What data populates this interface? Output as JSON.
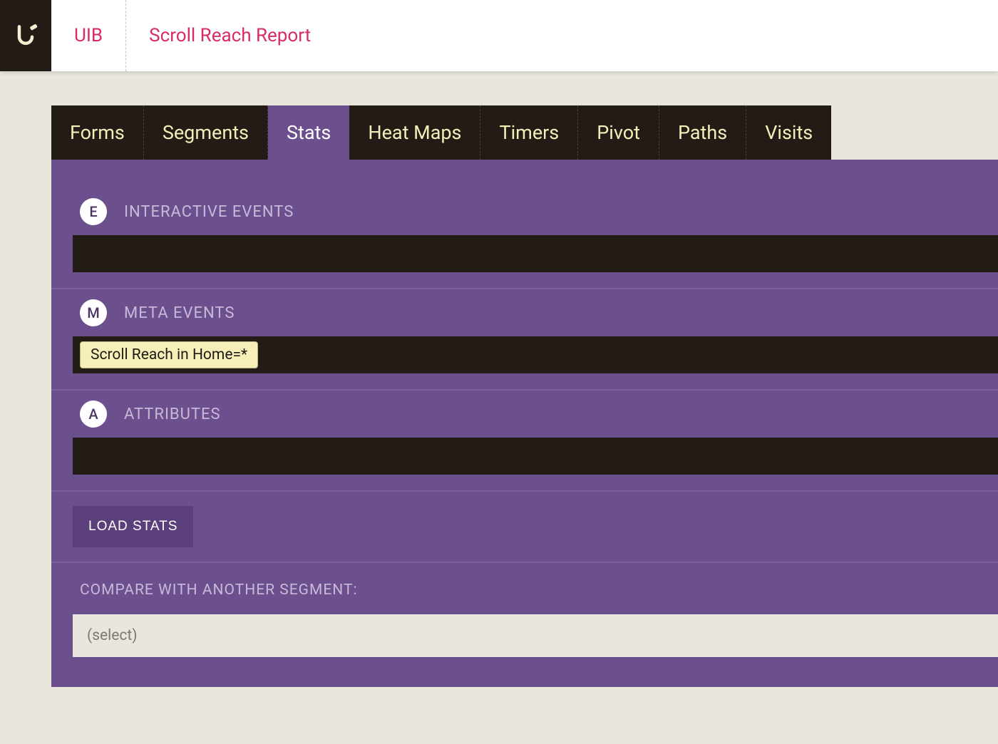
{
  "header": {
    "breadcrumbs": [
      "UIB",
      "Scroll Reach Report"
    ]
  },
  "tabs": {
    "items": [
      "Forms",
      "Segments",
      "Stats",
      "Heat Maps",
      "Timers",
      "Pivot",
      "Paths",
      "Visits"
    ],
    "active_index": 2
  },
  "sections": {
    "interactive_events": {
      "badge": "E",
      "title": "INTERACTIVE EVENTS",
      "chips": []
    },
    "meta_events": {
      "badge": "M",
      "title": "META EVENTS",
      "chips": [
        "Scroll Reach in Home=*"
      ]
    },
    "attributes": {
      "badge": "A",
      "title": "ATTRIBUTES",
      "chips": []
    }
  },
  "actions": {
    "load_stats": "LOAD STATS"
  },
  "compare": {
    "label": "COMPARE WITH ANOTHER SEGMENT:",
    "placeholder": "(select)"
  }
}
